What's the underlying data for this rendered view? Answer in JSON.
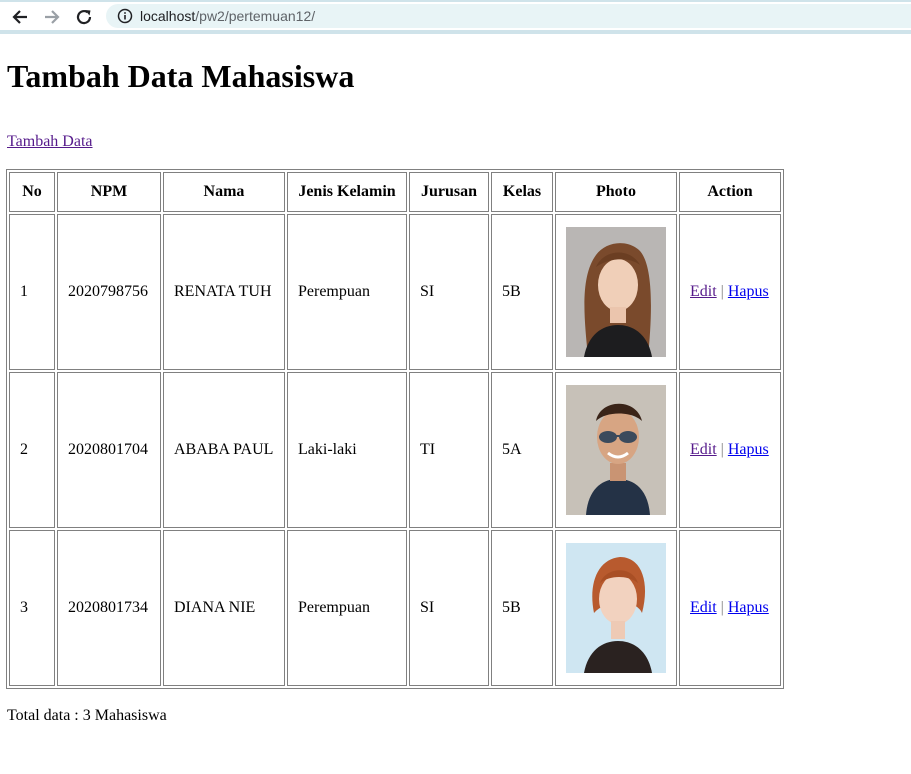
{
  "browser": {
    "url_host": "localhost",
    "url_path": "/pw2/pertemuan12/",
    "icons": [
      "back-arrow-icon",
      "forward-arrow-icon",
      "reload-icon",
      "info-icon"
    ]
  },
  "page": {
    "title": "Tambah Data Mahasiswa",
    "add_link": "Tambah Data",
    "total_text": "Total data : 3 Mahasiswa"
  },
  "table": {
    "headers": [
      "No",
      "NPM",
      "Nama",
      "Jenis Kelamin",
      "Jurusan",
      "Kelas",
      "Photo",
      "Action"
    ],
    "rows": [
      {
        "no": "1",
        "npm": "2020798756",
        "nama": "RENATA TUH",
        "jk": "Perempuan",
        "jurusan": "SI",
        "kelas": "5B",
        "edit": "Edit",
        "sep": "|",
        "hapus": "Hapus"
      },
      {
        "no": "2",
        "npm": "2020801704",
        "nama": "ABABA PAUL",
        "jk": "Laki-laki",
        "jurusan": "TI",
        "kelas": "5A",
        "edit": "Edit",
        "sep": "|",
        "hapus": "Hapus"
      },
      {
        "no": "3",
        "npm": "2020801734",
        "nama": "DIANA NIE",
        "jk": "Perempuan",
        "jurusan": "SI",
        "kelas": "5B",
        "edit": "Edit",
        "sep": "|",
        "hapus": "Hapus"
      }
    ]
  },
  "colors": {
    "visited_link": "#551a8b",
    "link": "#0000ee",
    "url_bar_bg": "#e8f4f6"
  }
}
